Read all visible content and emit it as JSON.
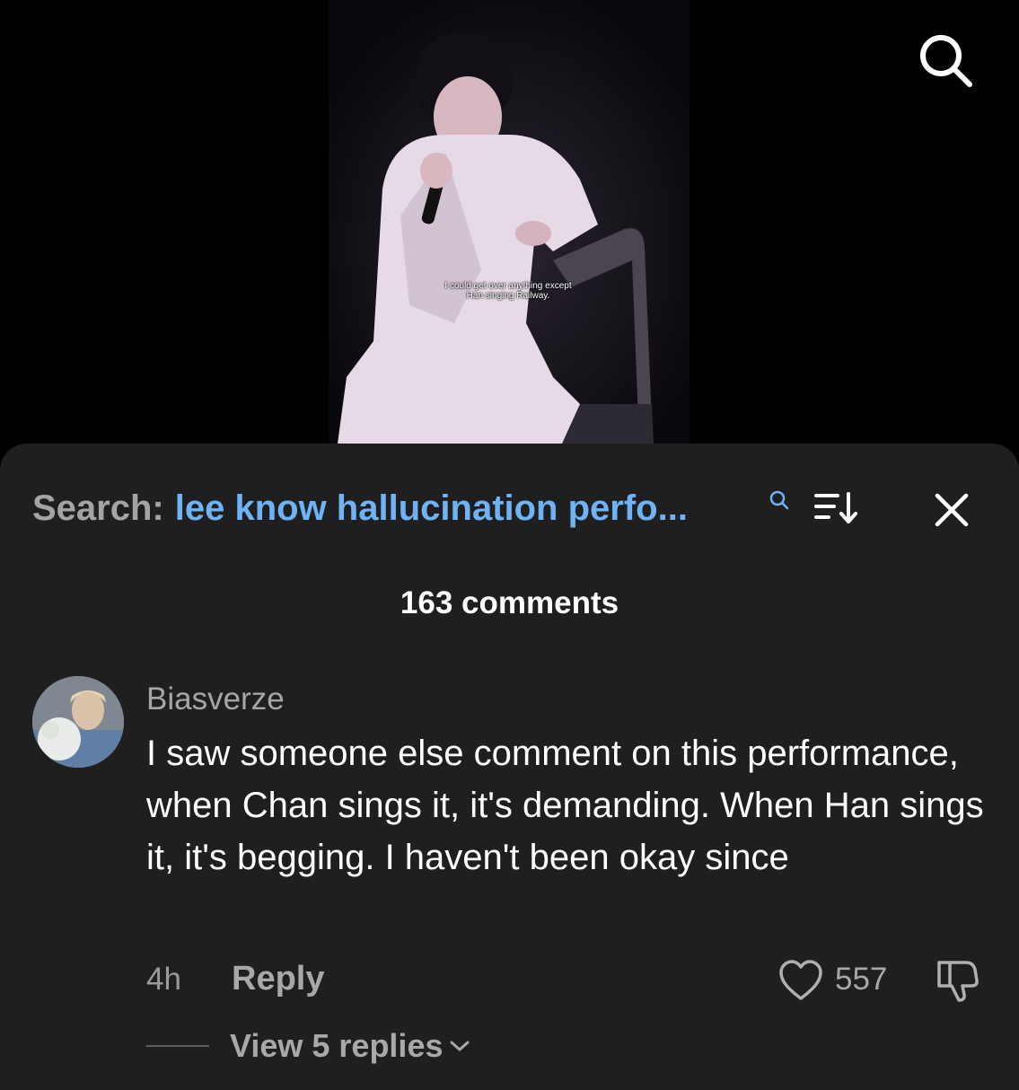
{
  "video": {
    "caption_lines": [
      "I could get over anything except",
      "Han singing Railway."
    ]
  },
  "icons": {
    "top_search": "search-icon",
    "search_mini": "search-icon",
    "sort": "sort-icon",
    "close": "close-icon",
    "like": "heart-icon",
    "dislike": "thumbs-down-icon",
    "expand": "chevron-down-icon"
  },
  "search_bar": {
    "prefix": "Search:",
    "query": "lee know hallucination perfo..."
  },
  "comments_header": {
    "count_label": "163 comments"
  },
  "comment": {
    "username": "Biasverze",
    "text": "I saw someone else comment on this performance, when Chan sings it, it's demanding. When Han sings it, it's begging. I haven't been okay since",
    "time": "4h",
    "reply_label": "Reply",
    "likes": "557",
    "view_replies_label": "View 5 replies"
  },
  "colors": {
    "sheet_bg": "#1f1f1f",
    "query_blue": "#6fb3f5",
    "muted_text": "#a6a6a6"
  }
}
